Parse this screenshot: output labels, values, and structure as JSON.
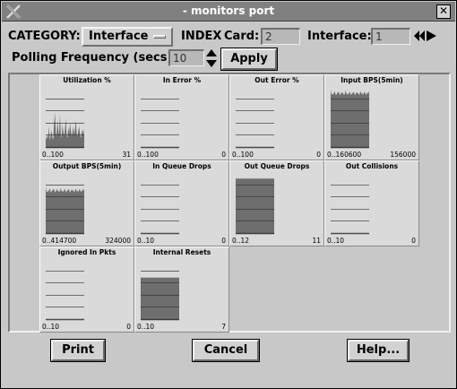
{
  "window": {
    "title": "- monitors port"
  },
  "controls": {
    "category_label": "CATEGORY:",
    "category_value": "Interface",
    "index_label": "INDEX",
    "card_label": "Card:",
    "card_value": "2",
    "interface_label": "Interface:",
    "interface_value": "1",
    "polling_label": "Polling Frequency (secs):",
    "polling_value": "10",
    "apply_label": "Apply"
  },
  "graphs": [
    {
      "title": "Utilization %",
      "range": "0..100",
      "value": "31",
      "kind": "spiky",
      "level": 0.31,
      "max": 100
    },
    {
      "title": "In Error %",
      "range": "0..100",
      "value": "0",
      "kind": "flat",
      "level": 0,
      "max": 100
    },
    {
      "title": "Out Error %",
      "range": "0..100",
      "value": "0",
      "kind": "flat",
      "level": 0,
      "max": 100
    },
    {
      "title": "Input BPS(5min)",
      "range": "0..160600",
      "value": "156000",
      "kind": "wavy",
      "level": 0.97,
      "max": 160600
    },
    {
      "title": "Output BPS(5min)",
      "range": "0..414700",
      "value": "324000",
      "kind": "wavy",
      "level": 0.78,
      "max": 414700
    },
    {
      "title": "In Queue Drops",
      "range": "0..10",
      "value": "0",
      "kind": "flat",
      "level": 0,
      "max": 10
    },
    {
      "title": "Out Queue Drops",
      "range": "0..12",
      "value": "11",
      "kind": "solid",
      "level": 0.92,
      "max": 12
    },
    {
      "title": "Out Collisions",
      "range": "0..10",
      "value": "0",
      "kind": "flat",
      "level": 0,
      "max": 10
    },
    {
      "title": "Ignored In Pkts",
      "range": "0..10",
      "value": "0",
      "kind": "flat",
      "level": 0,
      "max": 10
    },
    {
      "title": "Internal Resets",
      "range": "0..10",
      "value": "7",
      "kind": "solid",
      "level": 0.7,
      "max": 10
    }
  ],
  "buttons": {
    "print": "Print",
    "cancel": "Cancel",
    "help": "Help..."
  },
  "colors": {
    "graph_fill": "#6e6e6e",
    "title_bar": "#808080"
  }
}
